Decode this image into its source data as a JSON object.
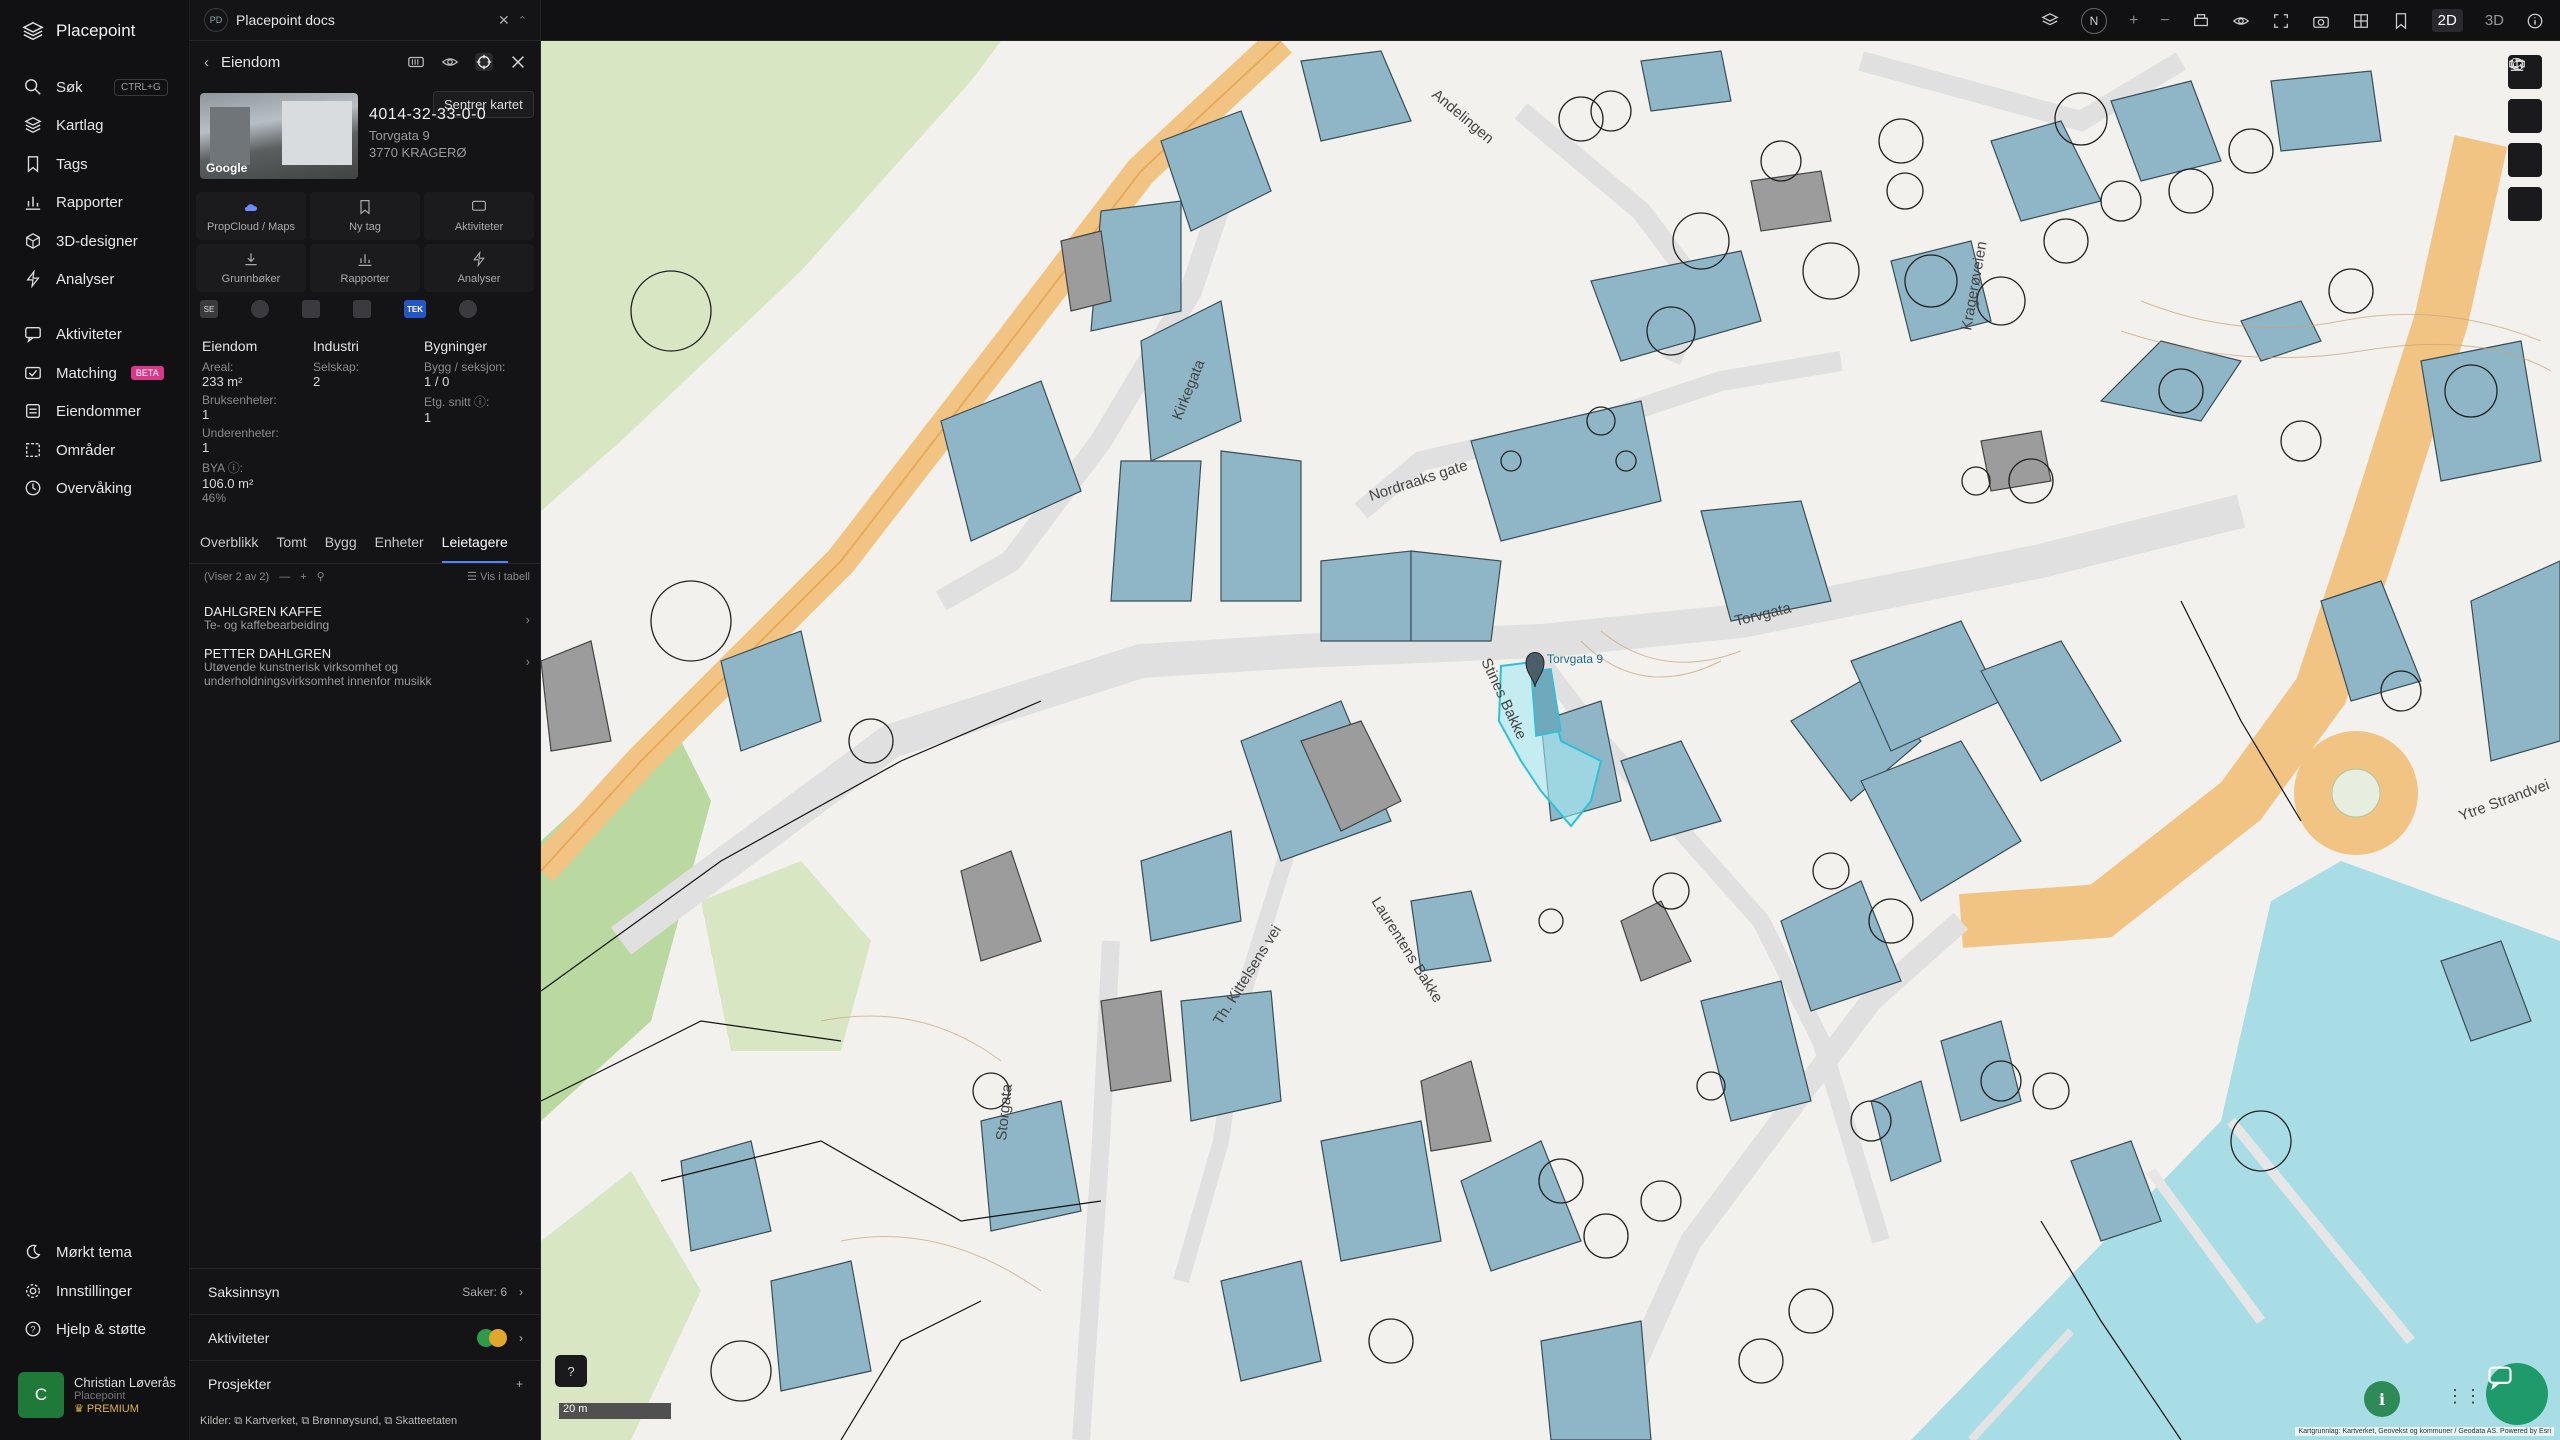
{
  "app": {
    "name": "Placepoint"
  },
  "nav": {
    "items": [
      {
        "label": "Søk",
        "shortcut": "CTRL+G"
      },
      {
        "label": "Kartlag"
      },
      {
        "label": "Tags"
      },
      {
        "label": "Rapporter"
      },
      {
        "label": "3D-designer"
      },
      {
        "label": "Analyser"
      },
      {
        "label": "Aktiviteter"
      },
      {
        "label": "Matching",
        "badge": "BETA"
      },
      {
        "label": "Eiendommer"
      },
      {
        "label": "Områder"
      },
      {
        "label": "Overvåking"
      }
    ],
    "bottom": [
      {
        "label": "Mørkt tema"
      },
      {
        "label": "Innstillinger"
      },
      {
        "label": "Hjelp & støtte"
      }
    ],
    "user": {
      "initial": "C",
      "name": "Christian Løverås",
      "org": "Placepoint",
      "plan": "PREMIUM"
    }
  },
  "panel": {
    "doc_badge": "PD",
    "doc_title": "Placepoint docs",
    "title": "Eiendom",
    "tooltip": "Sentrer kartet",
    "photo_brand": "Google",
    "property_id": "4014-32-33-0-0",
    "street": "Torvgata 9",
    "postal": "3770 KRAGERØ",
    "actions": [
      "PropCloud / Maps",
      "Ny tag",
      "Aktiviteter",
      "Grunnbøker",
      "Rapporter",
      "Analyser"
    ],
    "source_tek": "TEK",
    "info": {
      "col1_head": "Eiendom",
      "col2_head": "Industri",
      "col3_head": "Bygninger",
      "areal_label": "Areal:",
      "areal_value": "233 m²",
      "selskap_label": "Selskap:",
      "selskap_value": "2",
      "bygg_label": "Bygg / seksjon:",
      "bygg_value": "1 / 0",
      "bruks_label": "Bruksenheter:",
      "bruks_value": "1",
      "etg_label": "Etg. snitt ⓘ:",
      "etg_value": "1",
      "under_label": "Underenheter:",
      "under_value": "1",
      "bya_label": "BYA ⓘ:",
      "bya_value": "106.0 m²",
      "bya_pct": "46%"
    },
    "tabs": [
      "Overblikk",
      "Tomt",
      "Bygg",
      "Enheter",
      "Leietagere"
    ],
    "active_tab": "Leietagere",
    "list_count": "(Viser 2 av 2)",
    "list_view_label": "Vis i tabell",
    "tenants": [
      {
        "name": "DAHLGREN KAFFE",
        "desc": "Te- og kaffebearbeiding"
      },
      {
        "name": "PETTER DAHLGREN",
        "desc": "Utøvende kunstnerisk virksomhet og underholdningsvirksomhet innenfor musikk"
      }
    ],
    "sections": [
      {
        "label": "Saksinnsyn",
        "right": "Saker: 6"
      },
      {
        "label": "Aktiviteter",
        "right": ""
      },
      {
        "label": "Prosjekter",
        "right": "+"
      }
    ],
    "sources": "Kilder: ⧉ Kartverket, ⧉ Brønnøysund, ⧉ Skatteetaten"
  },
  "topbar": {
    "north": "N",
    "mode_2d": "2D",
    "mode_3d": "3D"
  },
  "map": {
    "streets": [
      "Torvgata",
      "Kirkegata",
      "Nordraaks gate",
      "Andelingen",
      "Stines Bakke",
      "Storgata",
      "Th. Kittelsens vei",
      "Laurentens Bakke",
      "Kragerøveien",
      "Ytre Strandvei"
    ],
    "selected_label": "Torvgata 9",
    "scale_label": "20 m",
    "help_label": "?",
    "info_label": "i",
    "attribution": "Kartgrunnlag: Kartverket, Geovekst og kommuner / Geodata AS. Powered by Esri"
  }
}
